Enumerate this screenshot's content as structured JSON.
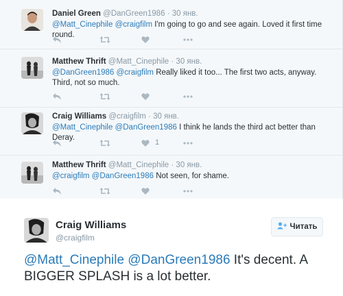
{
  "replies": [
    {
      "name": "Daniel Green",
      "handle": "@DanGreen1986",
      "date": "30 янв.",
      "mentions": "@Matt_Cinephile @craigfilm",
      "text": " I'm going to go and see again. Loved it first time round.",
      "likes": "",
      "avatar": "person-photo-avatar"
    },
    {
      "name": "Matthew Thrift",
      "handle": "@Matt_Cinephile",
      "date": "30 янв.",
      "mentions": "@DanGreen1986 @craigfilm",
      "text": " Really liked it too... The first two acts, anyway. Third, not so much.",
      "likes": "",
      "avatar": "couple-photo-avatar"
    },
    {
      "name": "Craig Williams",
      "handle": "@craigfilm",
      "date": "30 янв.",
      "mentions": "@Matt_Cinephile @DanGreen1986",
      "text": " I think he lands the third act better than Deray.",
      "likes": "1",
      "avatar": "portrait-photo-avatar"
    },
    {
      "name": "Matthew Thrift",
      "handle": "@Matt_Cinephile",
      "date": "30 янв.",
      "mentions": "@craigfilm @DanGreen1986",
      "text": " Not seen, for shame.",
      "likes": "",
      "avatar": "couple-photo-avatar"
    }
  ],
  "main_tweet": {
    "name": "Craig Williams",
    "handle": "@craigfilm",
    "follow_label": "Читать",
    "mentions": "@Matt_Cinephile @DanGreen1986",
    "text": " It's decent. A BIGGER SPLASH is a lot better."
  },
  "dot": "·",
  "colors": {
    "link": "#2b7bb9",
    "muted": "#8899a6",
    "icon": "#aab8c2",
    "thread_bg": "#f5f8fa"
  }
}
